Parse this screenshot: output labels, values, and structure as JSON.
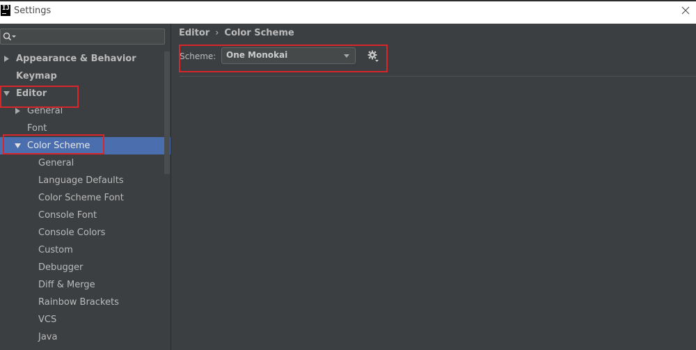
{
  "window": {
    "title": "Settings",
    "app_icon_text": "IJ"
  },
  "search": {
    "placeholder": "",
    "value": ""
  },
  "tree": [
    {
      "label": "Appearance & Behavior",
      "level": 0,
      "bold": true,
      "arrow": "right"
    },
    {
      "label": "Keymap",
      "level": 0,
      "bold": true,
      "arrow": ""
    },
    {
      "label": "Editor",
      "level": 0,
      "bold": true,
      "arrow": "down"
    },
    {
      "label": "General",
      "level": 1,
      "bold": false,
      "arrow": "right"
    },
    {
      "label": "Font",
      "level": 1,
      "bold": false,
      "arrow": ""
    },
    {
      "label": "Color Scheme",
      "level": 1,
      "bold": false,
      "arrow": "down",
      "selected": true
    },
    {
      "label": "General",
      "level": 2,
      "bold": false,
      "arrow": ""
    },
    {
      "label": "Language Defaults",
      "level": 2,
      "bold": false,
      "arrow": ""
    },
    {
      "label": "Color Scheme Font",
      "level": 2,
      "bold": false,
      "arrow": ""
    },
    {
      "label": "Console Font",
      "level": 2,
      "bold": false,
      "arrow": ""
    },
    {
      "label": "Console Colors",
      "level": 2,
      "bold": false,
      "arrow": ""
    },
    {
      "label": "Custom",
      "level": 2,
      "bold": false,
      "arrow": ""
    },
    {
      "label": "Debugger",
      "level": 2,
      "bold": false,
      "arrow": ""
    },
    {
      "label": "Diff & Merge",
      "level": 2,
      "bold": false,
      "arrow": ""
    },
    {
      "label": "Rainbow Brackets",
      "level": 2,
      "bold": false,
      "arrow": ""
    },
    {
      "label": "VCS",
      "level": 2,
      "bold": false,
      "arrow": ""
    },
    {
      "label": "Java",
      "level": 2,
      "bold": false,
      "arrow": ""
    }
  ],
  "breadcrumb": {
    "parent": "Editor",
    "separator": "›",
    "current": "Color Scheme"
  },
  "scheme": {
    "label": "Scheme:",
    "value": "One Monokai"
  },
  "colors": {
    "background": "#3c3f41",
    "selection": "#4b6eaf",
    "highlight_box": "#d8262b"
  }
}
